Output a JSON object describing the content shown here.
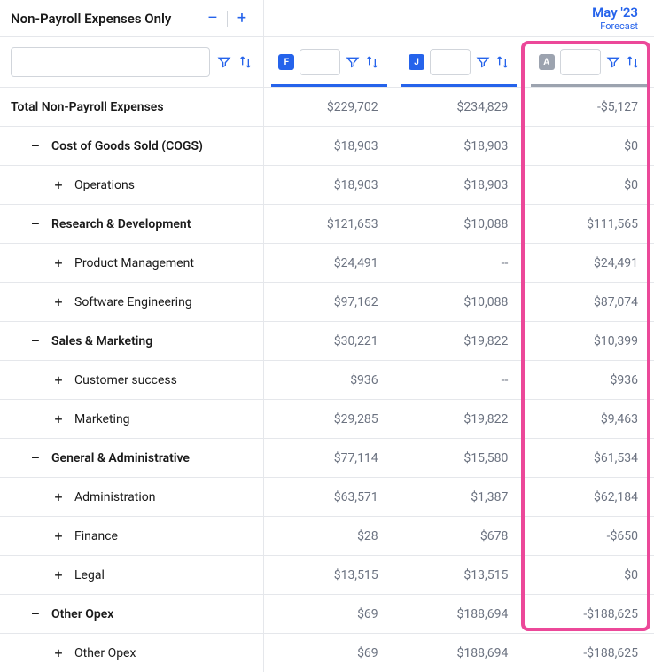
{
  "header": {
    "title": "Non-Payroll Expenses Only",
    "month": "May '23",
    "subtitle": "Forecast"
  },
  "columns": {
    "c1": {
      "badge": "F"
    },
    "c2": {
      "badge": "J"
    },
    "c3": {
      "badge": "A"
    }
  },
  "rows": [
    {
      "label": "Total Non-Payroll Expenses",
      "v1": "$229,702",
      "v2": "$234,829",
      "v3": "-$5,127",
      "bold": true,
      "icon": "",
      "indent": 0
    },
    {
      "label": "Cost of Goods Sold (COGS)",
      "v1": "$18,903",
      "v2": "$18,903",
      "v3": "$0",
      "bold": true,
      "icon": "–",
      "indent": 1
    },
    {
      "label": "Operations",
      "v1": "$18,903",
      "v2": "$18,903",
      "v3": "$0",
      "bold": false,
      "icon": "+",
      "indent": 2
    },
    {
      "label": "Research & Development",
      "v1": "$121,653",
      "v2": "$10,088",
      "v3": "$111,565",
      "bold": true,
      "icon": "–",
      "indent": 1
    },
    {
      "label": "Product Management",
      "v1": "$24,491",
      "v2": "--",
      "v3": "$24,491",
      "bold": false,
      "icon": "+",
      "indent": 2
    },
    {
      "label": "Software Engineering",
      "v1": "$97,162",
      "v2": "$10,088",
      "v3": "$87,074",
      "bold": false,
      "icon": "+",
      "indent": 2
    },
    {
      "label": "Sales & Marketing",
      "v1": "$30,221",
      "v2": "$19,822",
      "v3": "$10,399",
      "bold": true,
      "icon": "–",
      "indent": 1
    },
    {
      "label": "Customer success",
      "v1": "$936",
      "v2": "--",
      "v3": "$936",
      "bold": false,
      "icon": "+",
      "indent": 2
    },
    {
      "label": "Marketing",
      "v1": "$29,285",
      "v2": "$19,822",
      "v3": "$9,463",
      "bold": false,
      "icon": "+",
      "indent": 2
    },
    {
      "label": "General & Administrative",
      "v1": "$77,114",
      "v2": "$15,580",
      "v3": "$61,534",
      "bold": true,
      "icon": "–",
      "indent": 1
    },
    {
      "label": "Administration",
      "v1": "$63,571",
      "v2": "$1,387",
      "v3": "$62,184",
      "bold": false,
      "icon": "+",
      "indent": 2
    },
    {
      "label": "Finance",
      "v1": "$28",
      "v2": "$678",
      "v3": "-$650",
      "bold": false,
      "icon": "+",
      "indent": 2
    },
    {
      "label": "Legal",
      "v1": "$13,515",
      "v2": "$13,515",
      "v3": "$0",
      "bold": false,
      "icon": "+",
      "indent": 2
    },
    {
      "label": "Other Opex",
      "v1": "$69",
      "v2": "$188,694",
      "v3": "-$188,625",
      "bold": true,
      "icon": "–",
      "indent": 1
    },
    {
      "label": "Other Opex",
      "v1": "$69",
      "v2": "$188,694",
      "v3": "-$188,625",
      "bold": false,
      "icon": "+",
      "indent": 2
    }
  ]
}
